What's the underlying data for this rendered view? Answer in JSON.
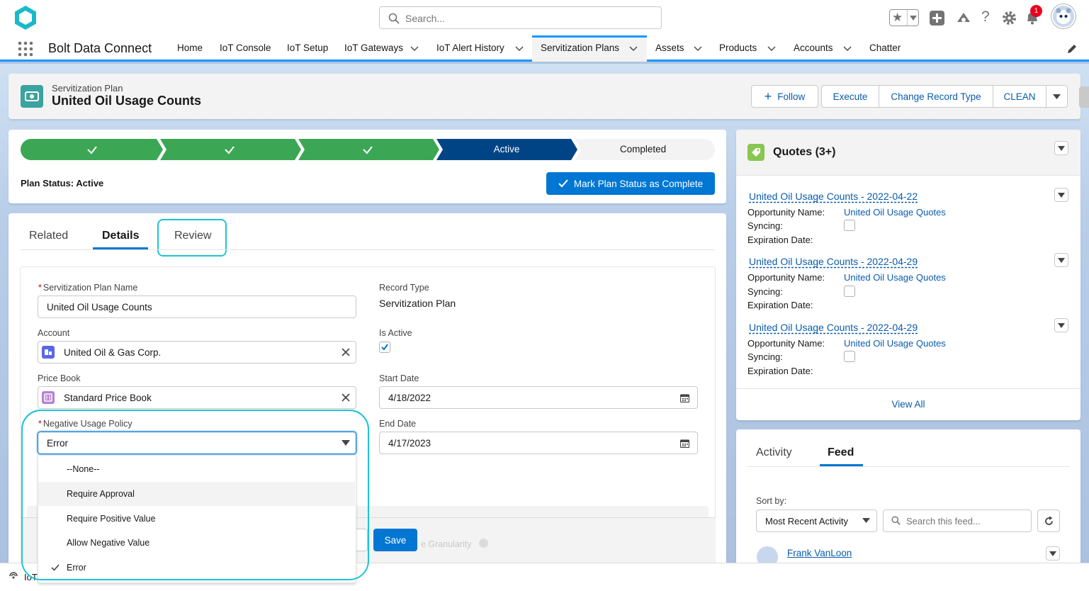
{
  "header": {
    "search_placeholder": "Search...",
    "notification_count": "1"
  },
  "nav": {
    "app_name": "Bolt Data Connect",
    "items": [
      "Home",
      "IoT Console",
      "IoT Setup",
      "IoT Gateways",
      "IoT Alert History",
      "Servitization Plans",
      "Assets",
      "Products",
      "Accounts",
      "Chatter"
    ]
  },
  "record": {
    "object_label": "Servitization Plan",
    "title": "United Oil Usage Counts",
    "actions": {
      "follow": "Follow",
      "execute": "Execute",
      "change_record_type": "Change Record Type",
      "clean": "CLEAN"
    }
  },
  "path": {
    "stages": [
      "",
      "",
      "",
      "Active",
      "Completed"
    ],
    "status_label": "Plan Status: Active",
    "mark_button": "Mark Plan Status as Complete"
  },
  "tabs": {
    "related": "Related",
    "details": "Details",
    "review": "Review"
  },
  "form": {
    "plan_name_label": "Servitization Plan Name",
    "plan_name_value": "United Oil Usage Counts",
    "record_type_label": "Record Type",
    "record_type_value": "Servitization Plan",
    "account_label": "Account",
    "account_value": "United Oil & Gas Corp.",
    "is_active_label": "Is Active",
    "is_active": true,
    "price_book_label": "Price Book",
    "price_book_value": "Standard Price Book",
    "start_date_label": "Start Date",
    "start_date_value": "4/18/2022",
    "policy_label": "Negative Usage Policy",
    "policy_value": "Error",
    "end_date_label": "End Date",
    "end_date_value": "4/17/2023",
    "policy_options": [
      "--None--",
      "Require Approval",
      "Require Positive Value",
      "Allow Negative Value",
      "Error"
    ],
    "hidden_field_label": "e Granularity",
    "save_button": "Save"
  },
  "quotes": {
    "title": "Quotes (3+)",
    "opportunity_label": "Opportunity Name:",
    "syncing_label": "Syncing:",
    "expiration_label": "Expiration Date:",
    "items": [
      {
        "name": "United Oil Usage Counts - 2022-04-22",
        "opportunity": "United Oil Usage Quotes"
      },
      {
        "name": "United Oil Usage Counts - 2022-04-29",
        "opportunity": "United Oil Usage Quotes"
      },
      {
        "name": "United Oil Usage Counts - 2022-04-29",
        "opportunity": "United Oil Usage Quotes"
      }
    ],
    "view_all": "View All"
  },
  "feed": {
    "tab_activity": "Activity",
    "tab_feed": "Feed",
    "sort_label": "Sort by:",
    "sort_value": "Most Recent Activity",
    "search_placeholder": "Search this feed...",
    "first_author": "Frank VanLoon"
  },
  "utility": {
    "label": "IoT"
  },
  "colors": {
    "brand": "#0176d3",
    "path_complete": "#3ba755",
    "path_current": "#014486",
    "highlight": "#1ec4d6"
  }
}
